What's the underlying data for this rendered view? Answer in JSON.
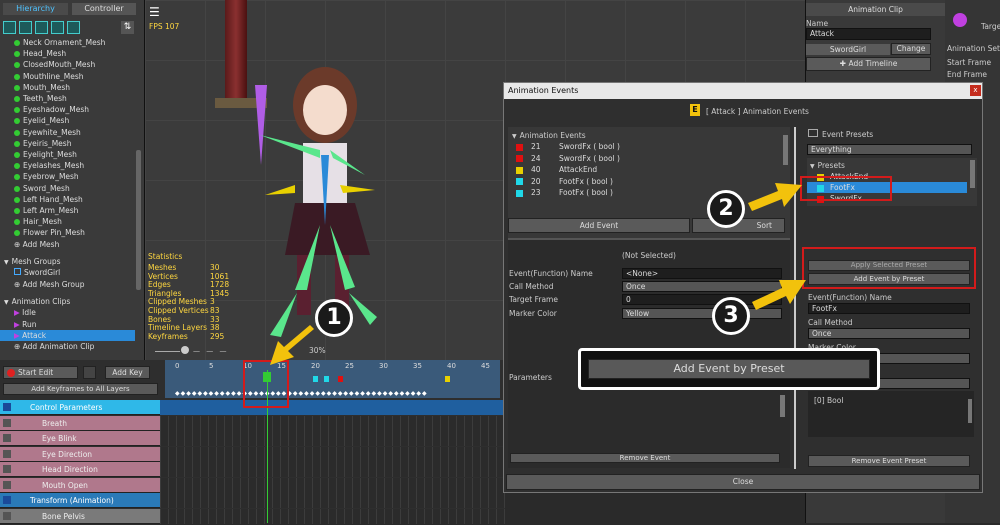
{
  "left_panel": {
    "tab_hierarchy": "Hierarchy",
    "tab_controller": "Controller",
    "meshes": [
      "Neck Ornament_Mesh",
      "Head_Mesh",
      "ClosedMouth_Mesh",
      "Mouthline_Mesh",
      "Mouth_Mesh",
      "Teeth_Mesh",
      "Eyeshadow_Mesh",
      "Eyelid_Mesh",
      "Eyewhite_Mesh",
      "Eyeiris_Mesh",
      "Eyelight_Mesh",
      "Eyelashes_Mesh",
      "Eyebrow_Mesh",
      "Sword_Mesh",
      "Left Hand_Mesh",
      "Left Arm_Mesh",
      "Hair_Mesh",
      "Flower Pin_Mesh"
    ],
    "add_mesh": "Add Mesh",
    "mesh_groups": "Mesh Groups",
    "mesh_group_item": "SwordGirl",
    "add_mesh_group": "Add Mesh Group",
    "animation_clips": "Animation Clips",
    "clips": [
      "Idle",
      "Run",
      "Attack"
    ],
    "add_clip": "Add Animation Clip"
  },
  "viewport": {
    "fps": "FPS 107",
    "stats_title": "Statistics",
    "stats": [
      [
        "Meshes",
        "30"
      ],
      [
        "Vertices",
        "1061"
      ],
      [
        "Edges",
        "1728"
      ],
      [
        "Triangles",
        "1345"
      ],
      [
        "Clipped Meshes",
        "3"
      ],
      [
        "Clipped Vertices",
        "83"
      ],
      [
        "Bones",
        "33"
      ],
      [
        "Timeline Layers",
        "38"
      ],
      [
        "Keyframes",
        "295"
      ]
    ],
    "zoom": "30%"
  },
  "timeline": {
    "start_edit": "Start Edit",
    "add_key": "Add Key",
    "add_keyframes_all": "Add Keyframes to All Layers",
    "ruler": [
      "0",
      "5",
      "10",
      "15",
      "20",
      "25",
      "30",
      "35",
      "40",
      "45"
    ],
    "tracks": [
      "Control Parameters",
      "Breath",
      "Eye Blink",
      "Eye Direction",
      "Head Direction",
      "Mouth Open",
      "Transform (Animation)",
      "Bone Pelvis"
    ]
  },
  "right_panel": {
    "title": "Animation Clip",
    "name_label": "Name",
    "name_value": "Attack",
    "target": "SwordGirl",
    "change": "Change",
    "add_timeline": "Add Timeline",
    "side": [
      "Targe",
      "Animation Settin",
      "Start Frame",
      "End Frame"
    ]
  },
  "dialog": {
    "title": "Animation Events",
    "close_x": "x",
    "header": "[ Attack ] Animation Events",
    "events_label": "Animation Events",
    "events": [
      {
        "frame": "21",
        "name": "SwordFx  ( bool )",
        "color": "#e01010"
      },
      {
        "frame": "24",
        "name": "SwordFx  ( bool )",
        "color": "#e01010"
      },
      {
        "frame": "40",
        "name": "AttackEnd",
        "color": "#e8d000"
      },
      {
        "frame": "20",
        "name": "FootFx  ( bool )",
        "color": "#20d8e8"
      },
      {
        "frame": "23",
        "name": "FootFx  ( bool )",
        "color": "#20d8e8"
      }
    ],
    "add_event": "Add Event",
    "sort": "Sort",
    "not_selected": "(Not Selected)",
    "fn_label": "Event(Function) Name",
    "fn_value": "<None>",
    "call_label": "Call Method",
    "call_value": "Once",
    "target_label": "Target Frame",
    "target_value": "0",
    "marker_label": "Marker Color",
    "marker_value": "Yellow",
    "parameters": "Parameters",
    "remove_event": "Remove Event",
    "big_btn": "Add Event by Preset",
    "close": "Close",
    "presets_label": "Event Presets",
    "filter": "Everything",
    "presets": "Presets",
    "preset_items": [
      {
        "name": "AttackEnd",
        "color": "#e8d000"
      },
      {
        "name": "FootFx",
        "color": "#20d8e8"
      },
      {
        "name": "SwordFx",
        "color": "#e01010"
      }
    ],
    "apply_preset": "Apply Selected Preset",
    "add_by_preset": "Add Event by Preset",
    "p_fn_label": "Event(Function) Name",
    "p_fn_value": "FootFx",
    "p_call_label": "Call Method",
    "p_call_value": "Once",
    "p_marker_label": "Marker Color",
    "param_item": "[0] Bool",
    "remove_preset": "Remove Event Preset"
  },
  "badges": [
    "1",
    "2",
    "3"
  ],
  "colors": {
    "accent": "#2a8ad8",
    "highlight": "#d31b1b",
    "arrow": "#f2c20c"
  }
}
